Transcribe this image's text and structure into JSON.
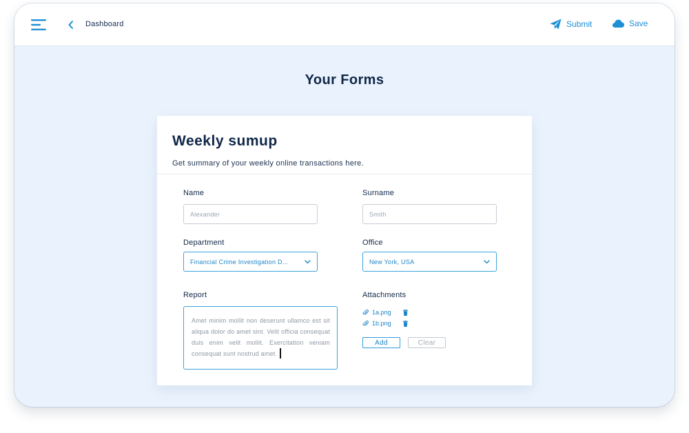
{
  "header": {
    "breadcrumb": "Dashboard",
    "submit_label": "Submit",
    "save_label": "Save",
    "accent": "#1c8fd6"
  },
  "page": {
    "title": "Your Forms"
  },
  "form": {
    "title": "Weekly sumup",
    "subtitle": "Get summary of your weekly online transactions here.",
    "name": {
      "label": "Name",
      "placeholder": "Alexander"
    },
    "surname": {
      "label": "Surname",
      "placeholder": "Smith"
    },
    "department": {
      "label": "Department",
      "value": "Financial Crime Investigation D..."
    },
    "office": {
      "label": "Office",
      "value": "New York, USA"
    },
    "report": {
      "label": "Report",
      "value": "Amet minim mollit non deserunt ullamco est sit aliqua dolor do amet sint. Velit officia consequat duis enim velit mollit. Exercitation veniam consequat sunt nostrud amet."
    },
    "attachments": {
      "label": "Attachments",
      "files": [
        "1a.png",
        "1b.png"
      ],
      "add_label": "Add",
      "clear_label": "Clear"
    }
  },
  "icons": {
    "menu": "menu-icon",
    "back": "chevron-left-icon",
    "submit": "paper-plane-icon",
    "save": "cloud-icon",
    "dropdown": "chevron-down-icon",
    "attachment": "paperclip-icon",
    "delete": "trash-icon"
  }
}
